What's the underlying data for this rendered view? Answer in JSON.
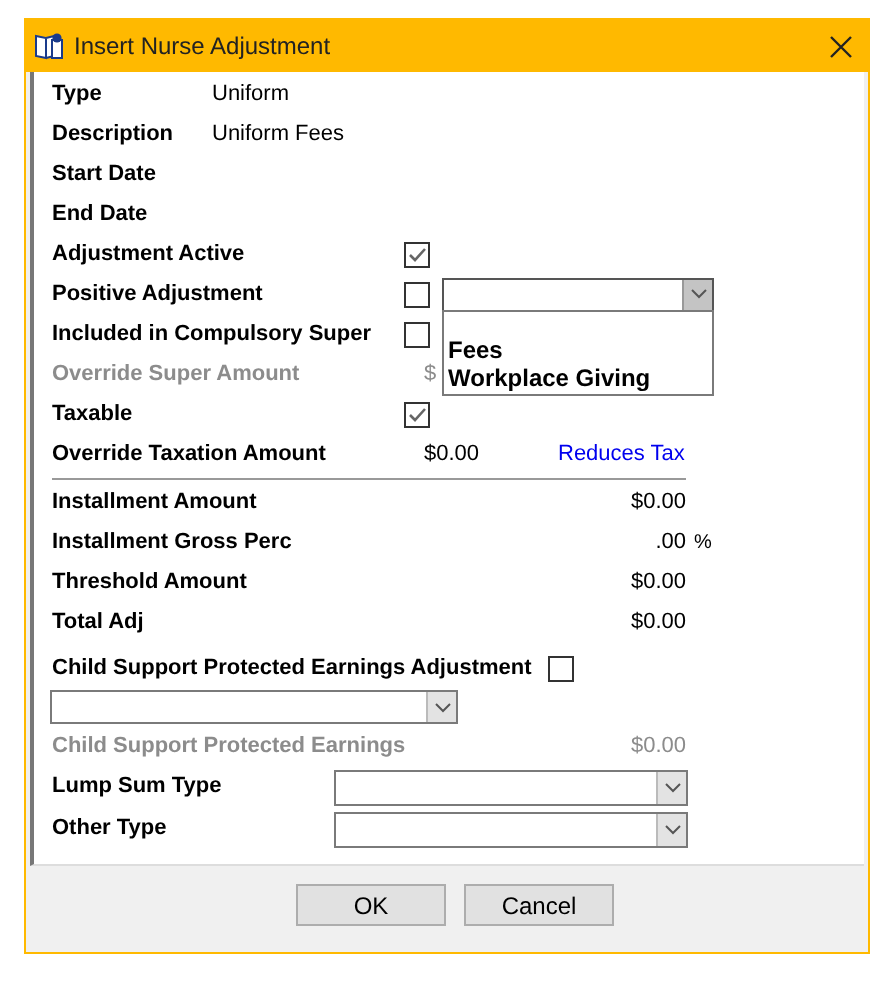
{
  "window": {
    "title": "Insert Nurse Adjustment"
  },
  "fields": [
    {
      "kind": "text",
      "label": "Type",
      "value": "Uniform"
    },
    {
      "kind": "text",
      "label": "Description",
      "value": "Uniform Fees"
    },
    {
      "kind": "text",
      "label": "Start Date"
    },
    {
      "kind": "text",
      "label": "End Date"
    },
    {
      "kind": "checkbox",
      "label": "Adjustment Active",
      "checked": true
    },
    {
      "kind": "checkbox_combo",
      "label": "Positive Adjustment",
      "checked": false,
      "dropdown": {
        "expanded": true,
        "options": [
          "Fees",
          "Workplace Giving"
        ]
      }
    },
    {
      "kind": "checkbox",
      "label": "Included in Compulsory Super",
      "checked": false
    },
    {
      "kind": "amount",
      "label": "Override Super Amount",
      "value": "$",
      "disabled": true
    },
    {
      "kind": "checkbox",
      "label": "Taxable",
      "checked": true
    },
    {
      "kind": "amount",
      "label": "Override Taxation Amount",
      "value": "$0.00",
      "link": "Reduces Tax",
      "disabled": false
    },
    {
      "kind": "divider"
    },
    {
      "kind": "total",
      "label": "Installment Amount",
      "value": "$0.00",
      "disabled": false
    },
    {
      "kind": "total",
      "label": "Installment Gross Perc",
      "value": ".00",
      "unit": "%",
      "disabled": false
    },
    {
      "kind": "total",
      "label": "Threshold Amount",
      "value": "$0.00",
      "disabled": false
    },
    {
      "kind": "total",
      "label": "Total Adj",
      "value": "$0.00",
      "disabled": false
    },
    {
      "kind": "checkbox_inline",
      "label": "Child Support Protected Earnings Adjustment",
      "checked": false
    },
    {
      "kind": "combo"
    },
    {
      "kind": "total",
      "label": "Child Support Protected Earnings",
      "value": "$0.00",
      "disabled": true
    },
    {
      "kind": "select",
      "label": "Lump Sum Type"
    },
    {
      "kind": "select",
      "label": "Other Type"
    }
  ],
  "buttons": [
    "OK",
    "Cancel"
  ]
}
